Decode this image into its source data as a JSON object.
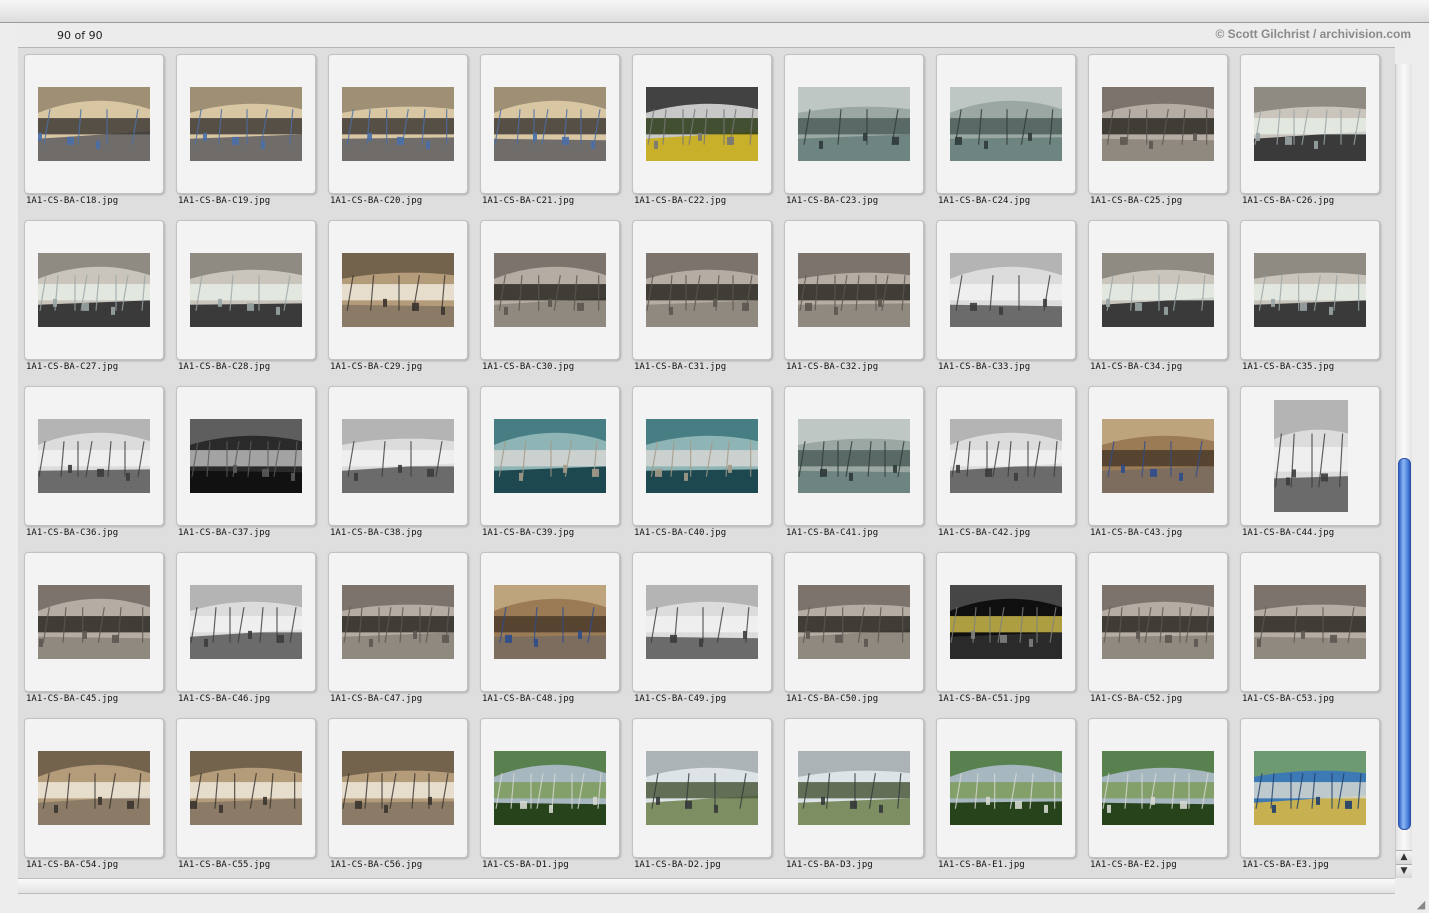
{
  "header": {
    "count_label": "90 of 90",
    "copyright": "© Scott Gilchrist / archivision.com"
  },
  "scroll": {
    "position": 0.98,
    "visible_fraction": 0.48
  },
  "thumbnails": [
    {
      "label": "1A1-CS-BA-C18.jpg",
      "palette": "terminal"
    },
    {
      "label": "1A1-CS-BA-C19.jpg",
      "palette": "terminal"
    },
    {
      "label": "1A1-CS-BA-C20.jpg",
      "palette": "terminal"
    },
    {
      "label": "1A1-CS-BA-C21.jpg",
      "palette": "terminal"
    },
    {
      "label": "1A1-CS-BA-C22.jpg",
      "palette": "board"
    },
    {
      "label": "1A1-CS-BA-C23.jpg",
      "palette": "glass"
    },
    {
      "label": "1A1-CS-BA-C24.jpg",
      "palette": "glass"
    },
    {
      "label": "1A1-CS-BA-C25.jpg",
      "palette": "hall"
    },
    {
      "label": "1A1-CS-BA-C26.jpg",
      "palette": "window"
    },
    {
      "label": "1A1-CS-BA-C27.jpg",
      "palette": "window"
    },
    {
      "label": "1A1-CS-BA-C28.jpg",
      "palette": "window"
    },
    {
      "label": "1A1-CS-BA-C29.jpg",
      "palette": "ceiling"
    },
    {
      "label": "1A1-CS-BA-C30.jpg",
      "palette": "hall"
    },
    {
      "label": "1A1-CS-BA-C31.jpg",
      "palette": "hall"
    },
    {
      "label": "1A1-CS-BA-C32.jpg",
      "palette": "hall"
    },
    {
      "label": "1A1-CS-BA-C33.jpg",
      "palette": "white"
    },
    {
      "label": "1A1-CS-BA-C34.jpg",
      "palette": "window"
    },
    {
      "label": "1A1-CS-BA-C35.jpg",
      "palette": "window"
    },
    {
      "label": "1A1-CS-BA-C36.jpg",
      "palette": "white"
    },
    {
      "label": "1A1-CS-BA-C37.jpg",
      "palette": "dark"
    },
    {
      "label": "1A1-CS-BA-C38.jpg",
      "palette": "white"
    },
    {
      "label": "1A1-CS-BA-C39.jpg",
      "palette": "teal"
    },
    {
      "label": "1A1-CS-BA-C40.jpg",
      "palette": "teal"
    },
    {
      "label": "1A1-CS-BA-C41.jpg",
      "palette": "glass"
    },
    {
      "label": "1A1-CS-BA-C42.jpg",
      "palette": "white"
    },
    {
      "label": "1A1-CS-BA-C43.jpg",
      "palette": "bronze"
    },
    {
      "label": "1A1-CS-BA-C44.jpg",
      "palette": "white",
      "orientation": "portrait"
    },
    {
      "label": "1A1-CS-BA-C45.jpg",
      "palette": "hall"
    },
    {
      "label": "1A1-CS-BA-C46.jpg",
      "palette": "white"
    },
    {
      "label": "1A1-CS-BA-C47.jpg",
      "palette": "hall"
    },
    {
      "label": "1A1-CS-BA-C48.jpg",
      "palette": "bronze"
    },
    {
      "label": "1A1-CS-BA-C49.jpg",
      "palette": "white"
    },
    {
      "label": "1A1-CS-BA-C50.jpg",
      "palette": "hall"
    },
    {
      "label": "1A1-CS-BA-C51.jpg",
      "palette": "night"
    },
    {
      "label": "1A1-CS-BA-C52.jpg",
      "palette": "hall"
    },
    {
      "label": "1A1-CS-BA-C53.jpg",
      "palette": "hall"
    },
    {
      "label": "1A1-CS-BA-C54.jpg",
      "palette": "ceiling"
    },
    {
      "label": "1A1-CS-BA-C55.jpg",
      "palette": "ceiling"
    },
    {
      "label": "1A1-CS-BA-C56.jpg",
      "palette": "ceiling"
    },
    {
      "label": "1A1-CS-BA-D1.jpg",
      "palette": "green"
    },
    {
      "label": "1A1-CS-BA-D2.jpg",
      "palette": "sky"
    },
    {
      "label": "1A1-CS-BA-D3.jpg",
      "palette": "sky"
    },
    {
      "label": "1A1-CS-BA-E1.jpg",
      "palette": "green"
    },
    {
      "label": "1A1-CS-BA-E2.jpg",
      "palette": "green"
    },
    {
      "label": "1A1-CS-BA-E3.jpg",
      "palette": "map"
    }
  ],
  "palettes": {
    "terminal": [
      "#d9c7a3",
      "#8a7c66",
      "#3e3a36",
      "#6f6c6a",
      "#4a6fa8"
    ],
    "board": [
      "#c8c8c8",
      "#151515",
      "#2b3a16",
      "#c8b02a",
      "#777777"
    ],
    "glass": [
      "#9aa7a2",
      "#c9d2cf",
      "#4e5f5c",
      "#6e8481",
      "#2f3a38"
    ],
    "hall": [
      "#b5ada3",
      "#6a6259",
      "#2c2925",
      "#8f8980",
      "#5c5650"
    ],
    "window": [
      "#c9c5bc",
      "#7b7770",
      "#e6ece6",
      "#3a3a3a",
      "#9aa5a6"
    ],
    "ceiling": [
      "#b49b7a",
      "#5e503f",
      "#efe9dc",
      "#8b7a65",
      "#3a342d"
    ],
    "white": [
      "#dcdcdc",
      "#a7a7a7",
      "#f2f2f2",
      "#6b6b6b",
      "#3c3c3c"
    ],
    "dark": [
      "#2a2a2a",
      "#707070",
      "#b9b9b9",
      "#111111",
      "#5a5a5a"
    ],
    "teal": [
      "#8fb4b5",
      "#2f6c74",
      "#d5d6d2",
      "#1d4850",
      "#a49a88"
    ],
    "bronze": [
      "#9a7b55",
      "#c9b28b",
      "#4a3b2a",
      "#7d6d5e",
      "#2e4c8e"
    ],
    "night": [
      "#0f0f0f",
      "#5a5a5a",
      "#c8b74a",
      "#2a2a2a",
      "#808080"
    ],
    "green": [
      "#a7b7c0",
      "#3f6f2a",
      "#7d9c5a",
      "#26431b",
      "#d6d8d2"
    ],
    "sky": [
      "#dde3e6",
      "#9aa3a6",
      "#4c5a3c",
      "#7d8f62",
      "#35393b"
    ],
    "map": [
      "#3d79b5",
      "#7fa65b",
      "#d3d7d0",
      "#c7b04f",
      "#1f3f6a"
    ]
  }
}
